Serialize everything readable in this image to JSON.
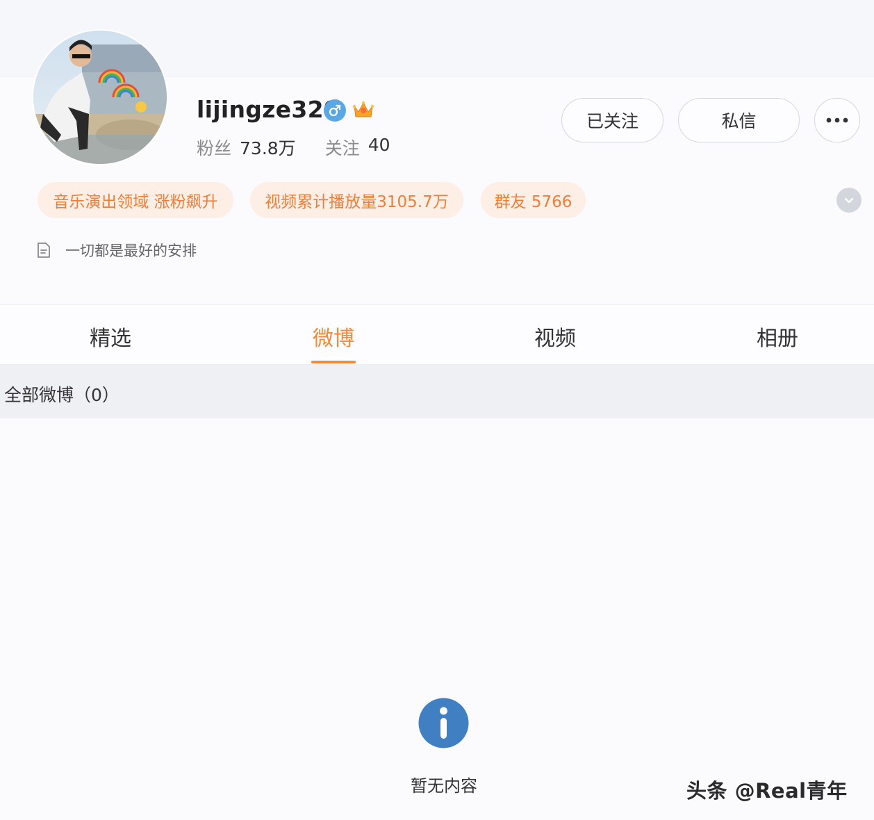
{
  "profile": {
    "username": "lijingze329",
    "fans_label": "粉丝",
    "fans_value": "73.8万",
    "following_label": "关注",
    "following_value": "40",
    "bio": "一切都是最好的安排"
  },
  "actions": {
    "follow_label": "已关注",
    "message_label": "私信",
    "more_label": "•••"
  },
  "tags": [
    "音乐演出领域 涨粉飙升",
    "视频累计播放量3105.7万",
    "群友 5766"
  ],
  "tabs": [
    {
      "label": "精选"
    },
    {
      "label": "微博",
      "active": true
    },
    {
      "label": "视频"
    },
    {
      "label": "相册"
    }
  ],
  "section": {
    "title": "全部微博（0）"
  },
  "empty_state": {
    "text": "暂无内容"
  },
  "watermark": "头条 @Real青年",
  "colors": {
    "accent": "#f28a3a",
    "tag_bg": "#fdeee6",
    "tag_text": "#ef7f38",
    "info_blue": "#3f7fc2",
    "gender_blue": "#5aa7e6"
  },
  "icons": {
    "gender": "male-icon",
    "badge": "crown-icon",
    "bio": "document-icon",
    "expand": "chevron-down-icon",
    "empty": "info-icon"
  }
}
